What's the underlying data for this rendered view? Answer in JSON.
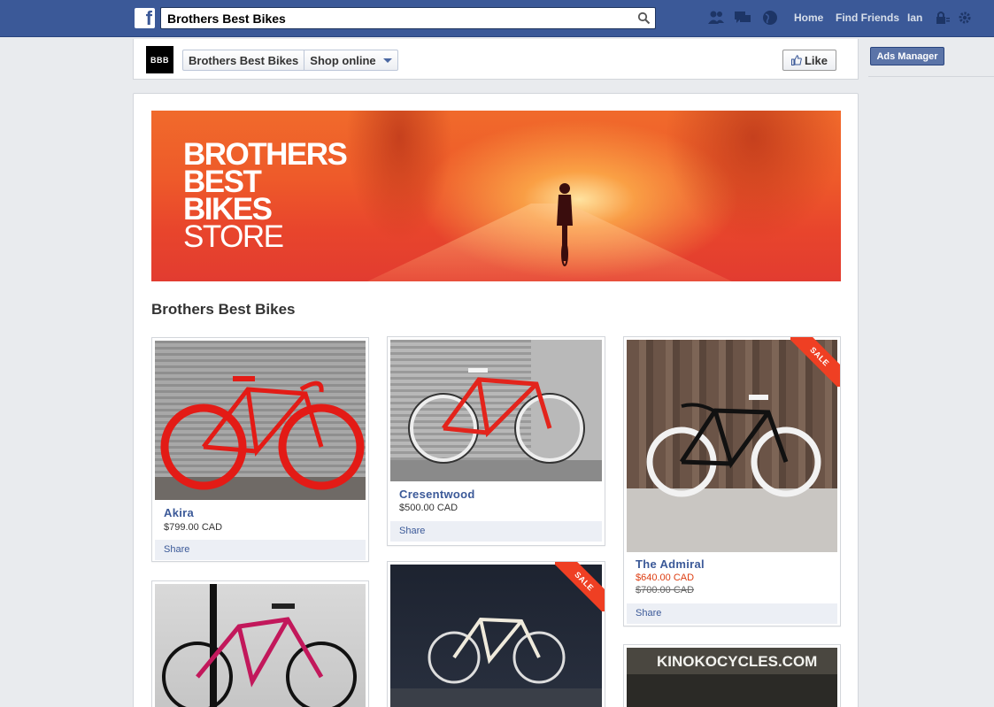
{
  "topbar": {
    "logo": "f",
    "search_value": "Brothers Best Bikes",
    "nav": {
      "home": "Home",
      "find_friends": "Find Friends",
      "user": "Ian"
    }
  },
  "page_header": {
    "logo_text": "BBB",
    "breadcrumb": {
      "page": "Brothers Best Bikes",
      "section": "Shop online"
    },
    "like_label": "Like"
  },
  "right_column": {
    "ads_manager": "Ads Manager"
  },
  "banner": {
    "lines": [
      "BROTHERS",
      "BEST",
      "BIKES",
      "STORE"
    ]
  },
  "shop": {
    "title": "Brothers Best Bikes",
    "products": [
      {
        "name": "Akira",
        "price": "$799.00 CAD",
        "share": "Share",
        "sale": false
      },
      {
        "name": "Cresentwood",
        "price": "$500.00 CAD",
        "share": "Share",
        "sale": false
      },
      {
        "name": "The Admiral",
        "price": "$640.00 CAD",
        "old_price": "$700.00 CAD",
        "share": "Share",
        "sale": true,
        "badge": "SALE"
      },
      {
        "name": "",
        "sale": false
      },
      {
        "name": "",
        "sale": true,
        "badge": "SALE"
      },
      {
        "name": "",
        "sale": false,
        "storefront_sign": "KINOKOCYCLES.COM"
      }
    ]
  },
  "colors": {
    "facebook_blue": "#3b5998",
    "sale_red": "#dd3c10",
    "ribbon_red": "#ef3f23"
  }
}
